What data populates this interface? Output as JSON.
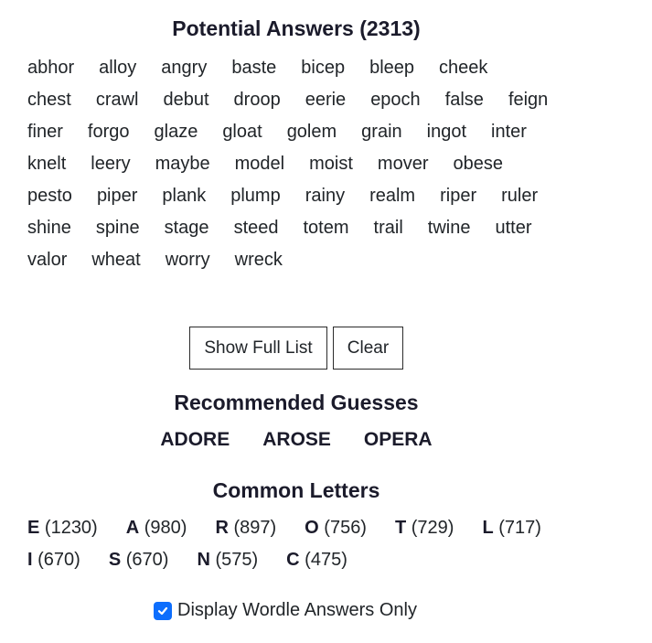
{
  "potential_answers": {
    "title": "Potential Answers (2313)",
    "words": [
      "abhor",
      "alloy",
      "angry",
      "baste",
      "bicep",
      "bleep",
      "cheek",
      "chest",
      "crawl",
      "debut",
      "droop",
      "eerie",
      "epoch",
      "false",
      "feign",
      "finer",
      "forgo",
      "glaze",
      "gloat",
      "golem",
      "grain",
      "ingot",
      "inter",
      "knelt",
      "leery",
      "maybe",
      "model",
      "moist",
      "mover",
      "obese",
      "pesto",
      "piper",
      "plank",
      "plump",
      "rainy",
      "realm",
      "riper",
      "ruler",
      "shine",
      "spine",
      "stage",
      "steed",
      "totem",
      "trail",
      "twine",
      "utter",
      "valor",
      "wheat",
      "worry",
      "wreck"
    ]
  },
  "buttons": {
    "show_full_list": "Show Full List",
    "clear": "Clear"
  },
  "recommended": {
    "title": "Recommended Guesses",
    "guesses": [
      "ADORE",
      "AROSE",
      "OPERA"
    ]
  },
  "common_letters": {
    "title": "Common Letters",
    "items": [
      {
        "letter": "E",
        "count": "(1230)"
      },
      {
        "letter": "A",
        "count": "(980)"
      },
      {
        "letter": "R",
        "count": "(897)"
      },
      {
        "letter": "O",
        "count": "(756)"
      },
      {
        "letter": "T",
        "count": "(729)"
      },
      {
        "letter": "L",
        "count": "(717)"
      },
      {
        "letter": "I",
        "count": "(670)"
      },
      {
        "letter": "S",
        "count": "(670)"
      },
      {
        "letter": "N",
        "count": "(575)"
      },
      {
        "letter": "C",
        "count": "(475)"
      }
    ]
  },
  "option": {
    "label": "Display Wordle Answers Only",
    "checked": true,
    "accent_color": "#0d6efd"
  }
}
